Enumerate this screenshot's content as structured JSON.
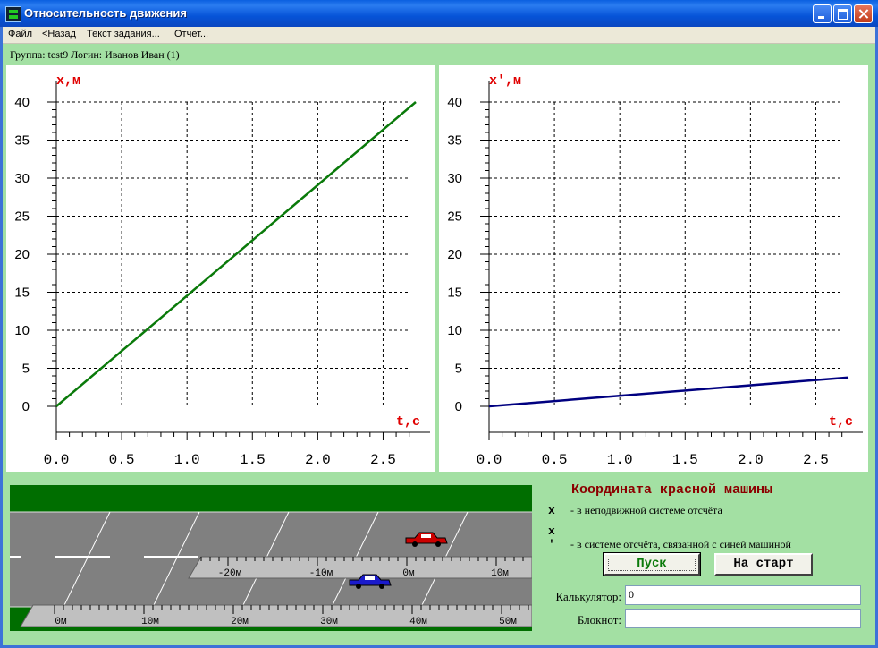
{
  "window": {
    "title": "Относительность движения"
  },
  "menu": {
    "items": [
      "Файл",
      "<Назад",
      "Текст задания...",
      "Отчет..."
    ]
  },
  "status": "Группа: test9  Логин: Иванов Иван (1)",
  "chart_data": [
    {
      "type": "line",
      "ylabel": "x,м",
      "xlabel": "t,с",
      "xlim": [
        0,
        2.75
      ],
      "ylim": [
        0,
        40
      ],
      "x_ticks": [
        "0.0",
        "0.5",
        "1.0",
        "1.5",
        "2.0",
        "2.5"
      ],
      "y_ticks": [
        "0",
        "5",
        "10",
        "15",
        "20",
        "25",
        "30",
        "35",
        "40"
      ],
      "grid": true,
      "series": [
        {
          "color": "#0a7a0a",
          "x": [
            0,
            2.75
          ],
          "y": [
            0,
            40
          ]
        }
      ]
    },
    {
      "type": "line",
      "ylabel": "x',м",
      "xlabel": "t,с",
      "xlim": [
        0,
        2.75
      ],
      "ylim": [
        0,
        40
      ],
      "x_ticks": [
        "0.0",
        "0.5",
        "1.0",
        "1.5",
        "2.0",
        "2.5"
      ],
      "y_ticks": [
        "0",
        "5",
        "10",
        "15",
        "20",
        "25",
        "30",
        "35",
        "40"
      ],
      "grid": true,
      "series": [
        {
          "color": "#000080",
          "x": [
            0,
            2.75
          ],
          "y": [
            0,
            3.8
          ]
        }
      ]
    }
  ],
  "road": {
    "upper_ruler": [
      "-20м",
      "-10м",
      "0м",
      "10м"
    ],
    "lower_ruler": [
      "0м",
      "10м",
      "20м",
      "30м",
      "40м",
      "50м"
    ],
    "red_car_color": "#cc0000",
    "blue_car_color": "#1a1acc"
  },
  "panel": {
    "title": "Координата красной машины",
    "legend": [
      {
        "symbol": "x",
        "text": "- в неподвижной системе отсчёта"
      },
      {
        "symbol": "x '",
        "text": "- в системе отсчёта, связанной с синей машиной"
      }
    ],
    "start_label": "Пуск",
    "reset_label": "На старт",
    "calc_label": "Калькулятор:",
    "calc_value": "0",
    "note_label": "Блокнот:",
    "note_value": ""
  }
}
